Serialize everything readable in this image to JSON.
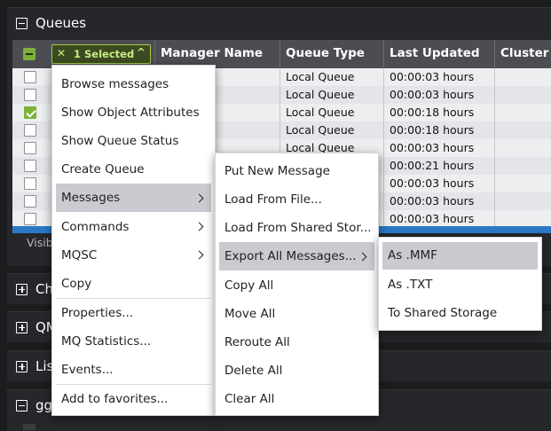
{
  "panels": {
    "queues": {
      "title": "Queues"
    },
    "collapsed": [
      {
        "title": "Ch"
      },
      {
        "title": "QM"
      },
      {
        "title": "Lis"
      },
      {
        "title": "gg"
      }
    ]
  },
  "grid": {
    "selected_chip": "1 Selected",
    "columns": [
      "Manager Name",
      "Queue Type",
      "Last Updated",
      "Cluster N"
    ],
    "rows": [
      {
        "checked": false,
        "queue_type": "Local Queue",
        "last_updated": "00:00:03 hours"
      },
      {
        "checked": false,
        "queue_type": "Local Queue",
        "last_updated": "00:00:03 hours"
      },
      {
        "checked": true,
        "queue_type": "Local Queue",
        "last_updated": "00:00:18 hours"
      },
      {
        "checked": false,
        "queue_type": "Local Queue",
        "last_updated": "00:00:18 hours"
      },
      {
        "checked": false,
        "queue_type": "Local Queue",
        "last_updated": "00:00:03 hours"
      },
      {
        "checked": false,
        "queue_type": "",
        "last_updated": "00:00:21 hours"
      },
      {
        "checked": false,
        "queue_type": "",
        "last_updated": "00:00:03 hours"
      },
      {
        "checked": false,
        "queue_type": "",
        "last_updated": "00:00:03 hours"
      },
      {
        "checked": false,
        "queue_type": "",
        "last_updated": "00:00:03 hours"
      }
    ],
    "footer_text": "Visib"
  },
  "context_menu": {
    "items": [
      "Browse messages",
      "Show Object Attributes",
      "Show Queue Status",
      "Create Queue",
      "Messages",
      "Commands",
      "MQSC",
      "Copy",
      "Properties...",
      "MQ Statistics...",
      "Events...",
      "Add to favorites..."
    ]
  },
  "messages_menu": {
    "items": [
      "Put New Message",
      "Load From File...",
      "Load From Shared Stor...",
      "Export All Messages...",
      "Copy All",
      "Move All",
      "Reroute All",
      "Delete All",
      "Clear All"
    ]
  },
  "export_menu": {
    "items": [
      "As .MMF",
      "As .TXT",
      "To Shared Storage"
    ]
  },
  "colors": {
    "accent_green": "#7db13a",
    "highlight": "#c9cbd0",
    "blue_bar": "#2c78c6"
  }
}
